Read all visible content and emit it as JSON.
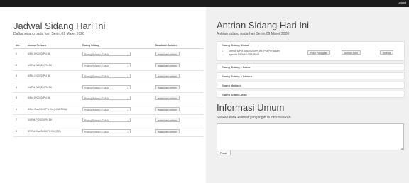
{
  "topbar": {
    "logout": "Logout"
  },
  "left": {
    "title": "Jadwal Sidang Hari Ini",
    "subtitle": "Daftar sidang pada hari Senin,09 Maret 2020",
    "headers": [
      "No.",
      "Nomor Perkara",
      "Ruang Sidang",
      "Masukkan Antrian"
    ],
    "rows": [
      {
        "no": "1",
        "perkara": "6/Pid.B/2020/PN Btl",
        "ruang": "Ruang Sidang UTAMA",
        "aksi": "masukkan antrian"
      },
      {
        "no": "2",
        "perkara": "10/Pid.B/2020/PN Btl",
        "ruang": "Ruang Sidang UTAMA",
        "aksi": "masukkan antrian"
      },
      {
        "no": "3",
        "perkara": "4/Pid.C/2020/PN Btl",
        "ruang": "Ruang Sidang UTAMA",
        "aksi": "masukkan antrian"
      },
      {
        "no": "4",
        "perkara": "14/Pid.B/2020/PN Btl",
        "ruang": "Ruang Sidang UTAMA",
        "aksi": "masukkan antrian"
      },
      {
        "no": "5",
        "perkara": "9/Pid.B/2020/PN Btl",
        "ruang": "Ruang Sidang UTAMA",
        "aksi": "masukkan antrian"
      },
      {
        "no": "6",
        "perkara": "8/Pid.Sus/2020/PN Btl (MINERBA)",
        "ruang": "Ruang Sidang UTAMA",
        "aksi": "masukkan antrian"
      },
      {
        "no": "7",
        "perkara": "10/Pdt.P/2020/PN Btl",
        "ruang": "Ruang Sidang UTAMA",
        "aksi": "masukkan antrian"
      },
      {
        "no": "8",
        "perkara": "87/Pid.Sus/2019/PN Btl (ITE)",
        "ruang": "Ruang Sidang UTAMA",
        "aksi": "masukkan antrian"
      }
    ]
  },
  "right": {
    "title": "Antrian Sidang Hari Ini",
    "subtitle": "Antrian sidang pada hari Senin,09 Maret 2020",
    "rooms": [
      {
        "name": "Ruang Sidang Utama",
        "entries": [
          {
            "index": "0.",
            "line1": "Nomor 6/Pid.Sus/2020/PN Btl (Pra Peradilan)",
            "line2": "agenda DEWAN PEMBINA",
            "btn_call": "Putar Panggilan",
            "btn_order": "Antrian Baru",
            "btn_done": "Selesai"
          }
        ]
      },
      {
        "name": "Ruang Sidang 1 Cakra"
      },
      {
        "name": "Ruang Sidang 2 Candra"
      },
      {
        "name": "Ruang Mediasi"
      },
      {
        "name": "Ruang Sidang Anak"
      }
    ],
    "info_title": "Informasi Umum",
    "info_subtitle": "Silakan ketik kalimat yang ingin di informasikan",
    "info_value": "",
    "putar": "Putar"
  }
}
